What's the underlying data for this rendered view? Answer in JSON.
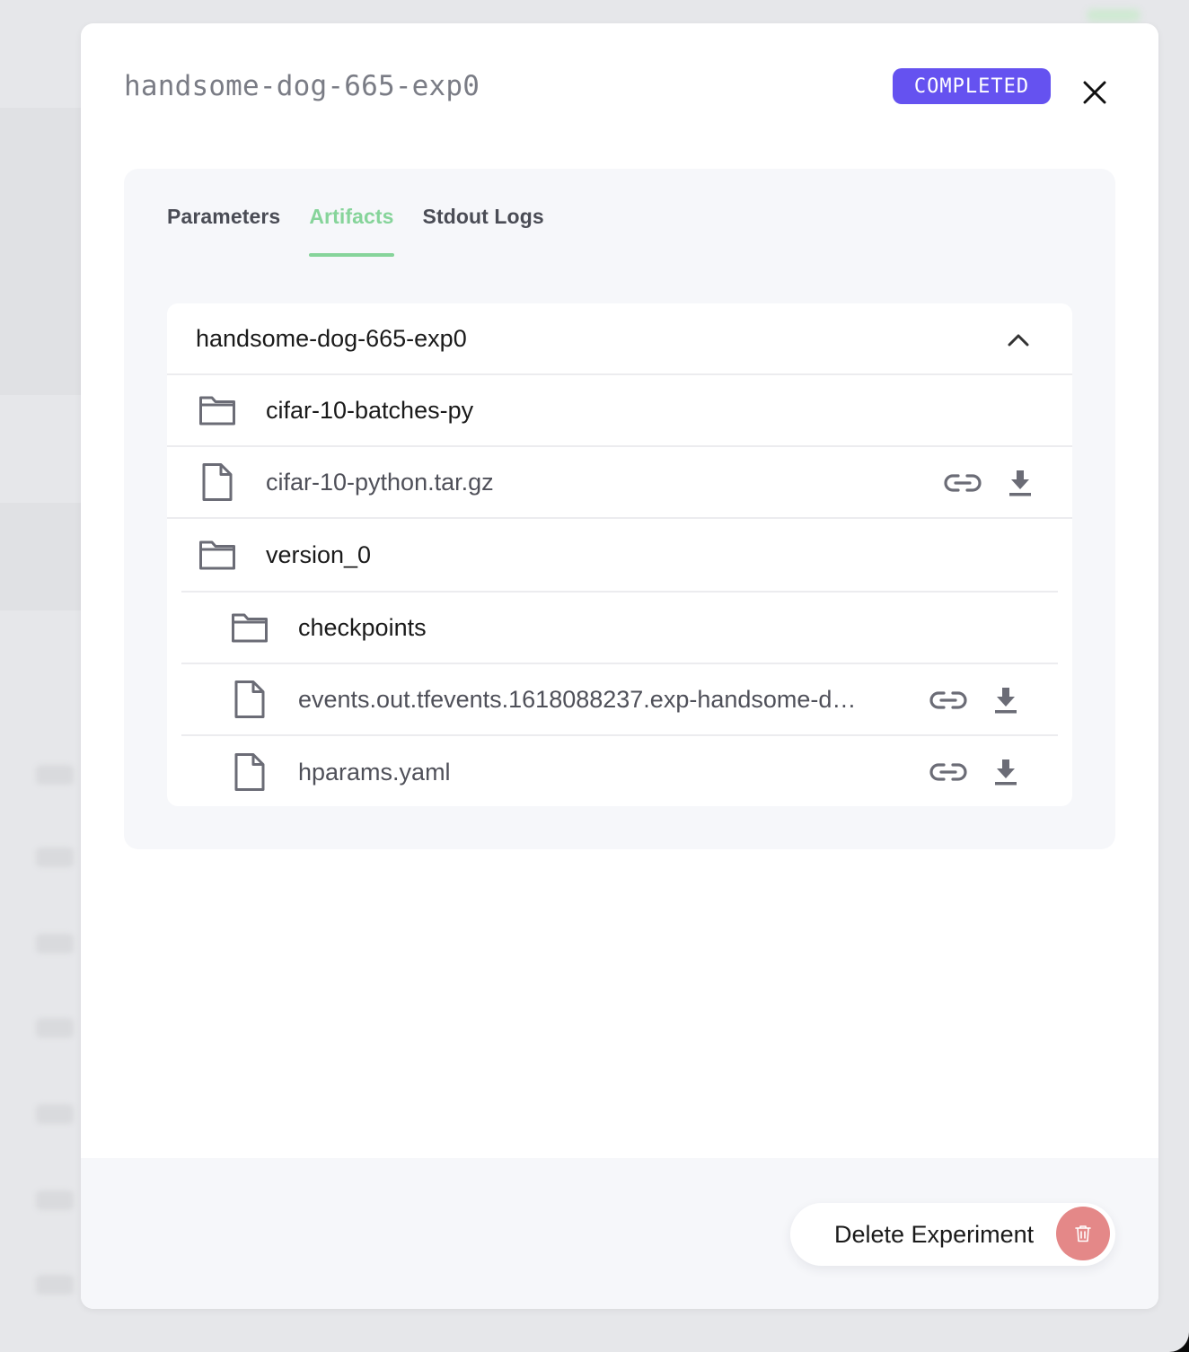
{
  "modal": {
    "title": "handsome-dog-665-exp0",
    "status": "COMPLETED",
    "status_color": "#6552f0"
  },
  "tabs": [
    {
      "label": "Parameters",
      "active": false
    },
    {
      "label": "Artifacts",
      "active": true
    },
    {
      "label": "Stdout Logs",
      "active": false
    }
  ],
  "accent_color": "#86d49a",
  "artifacts": {
    "root": "handsome-dog-665-exp0",
    "items": [
      {
        "type": "folder",
        "name": "cifar-10-batches-py",
        "depth": 0
      },
      {
        "type": "file",
        "name": "cifar-10-python.tar.gz",
        "depth": 0,
        "actions": [
          "link-icon",
          "download-icon"
        ]
      },
      {
        "type": "folder",
        "name": "version_0",
        "depth": 0
      },
      {
        "type": "folder",
        "name": "checkpoints",
        "depth": 1
      },
      {
        "type": "file",
        "name": "events.out.tfevents.1618088237.exp-handsome-d…",
        "depth": 1,
        "actions": [
          "link-icon",
          "download-icon"
        ]
      },
      {
        "type": "file",
        "name": "hparams.yaml",
        "depth": 1,
        "actions": [
          "link-icon",
          "download-icon"
        ]
      }
    ]
  },
  "footer": {
    "delete_label": "Delete Experiment",
    "delete_color": "#e48888"
  }
}
